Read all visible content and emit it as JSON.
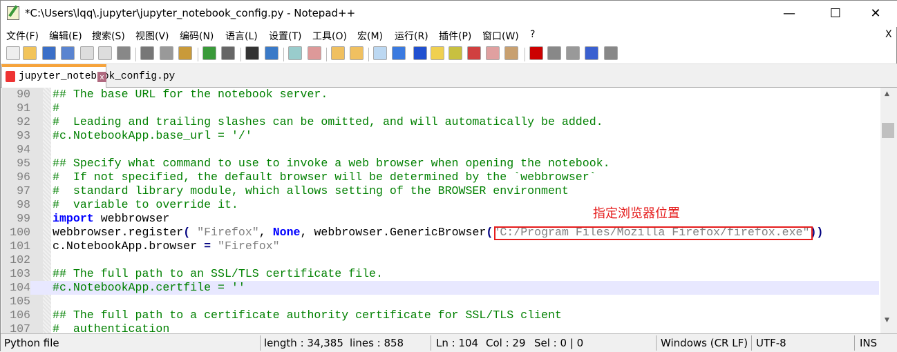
{
  "window": {
    "title": "*C:\\Users\\lqq\\.jupyter\\jupyter_notebook_config.py - Notepad++",
    "minimize": "—",
    "maximize": "☐",
    "close": "✕",
    "doc_close": "X"
  },
  "menu": [
    "文件(F)",
    "编辑(E)",
    "搜索(S)",
    "视图(V)",
    "编码(N)",
    "语言(L)",
    "设置(T)",
    "工具(O)",
    "宏(M)",
    "运行(R)",
    "插件(P)",
    "窗口(W)",
    "?"
  ],
  "toolbar": [
    "new-file",
    "open-file",
    "save",
    "save-all",
    "close",
    "close-all",
    "print",
    "cut",
    "copy",
    "paste",
    "undo",
    "redo",
    "find",
    "replace",
    "zoom-in",
    "zoom-out",
    "sync-vertical",
    "sync-horizontal",
    "word-wrap",
    "show-all-chars",
    "indent-guide",
    "language-define",
    "document-map",
    "function-list",
    "folder-workspace",
    "monitoring",
    "record-macro",
    "stop-record",
    "play-macro",
    "run-macro-multiple",
    "save-macro"
  ],
  "tab": {
    "label": "jupyter_notebook_config.py",
    "close": "x"
  },
  "lines": [
    {
      "n": "90",
      "seg": [
        [
          "cm",
          "## The base URL for the notebook server."
        ]
      ]
    },
    {
      "n": "91",
      "seg": [
        [
          "cm",
          "#"
        ]
      ]
    },
    {
      "n": "92",
      "seg": [
        [
          "cm",
          "#  Leading and trailing slashes can be omitted, and will automatically be added."
        ]
      ]
    },
    {
      "n": "93",
      "seg": [
        [
          "cm",
          "#c.NotebookApp.base_url = '/'"
        ]
      ]
    },
    {
      "n": "94",
      "seg": []
    },
    {
      "n": "95",
      "seg": [
        [
          "cm",
          "## Specify what command to use to invoke a web browser when opening the notebook."
        ]
      ]
    },
    {
      "n": "96",
      "seg": [
        [
          "cm",
          "#  If not specified, the default browser will be determined by the `webbrowser`"
        ]
      ]
    },
    {
      "n": "97",
      "seg": [
        [
          "cm",
          "#  standard library module, which allows setting of the BROWSER environment"
        ]
      ]
    },
    {
      "n": "98",
      "seg": [
        [
          "cm",
          "#  variable to override it."
        ]
      ]
    },
    {
      "n": "99",
      "seg": [
        [
          "kw",
          "import"
        ],
        [
          "df",
          " webbrowser"
        ]
      ]
    },
    {
      "n": "100",
      "seg": [
        [
          "df",
          "webbrowser.register"
        ],
        [
          "op",
          "("
        ],
        [
          "df",
          " "
        ],
        [
          "st",
          "\"Firefox\""
        ],
        [
          "df",
          ", "
        ],
        [
          "kw",
          "None"
        ],
        [
          "df",
          ", webbrowser.GenericBrowser"
        ],
        [
          "op",
          "("
        ],
        [
          "st",
          "\"C:/Program Files/Mozilla Firefox/firefox.exe\""
        ],
        [
          "op",
          "))"
        ]
      ]
    },
    {
      "n": "101",
      "seg": [
        [
          "df",
          "c.NotebookApp.browser "
        ],
        [
          "op",
          "="
        ],
        [
          "df",
          " "
        ],
        [
          "st",
          "\"Firefox\""
        ]
      ]
    },
    {
      "n": "102",
      "seg": []
    },
    {
      "n": "103",
      "seg": [
        [
          "cm",
          "## The full path to an SSL/TLS certificate file."
        ]
      ]
    },
    {
      "n": "104",
      "seg": [
        [
          "cm",
          "#c.NotebookApp.certfile = ''"
        ]
      ],
      "current": true
    },
    {
      "n": "105",
      "seg": []
    },
    {
      "n": "106",
      "seg": [
        [
          "cm",
          "## The full path to a certificate authority certificate for SSL/TLS client"
        ]
      ]
    },
    {
      "n": "107",
      "seg": [
        [
          "cm",
          "#  authentication"
        ]
      ]
    }
  ],
  "annotation": "指定浏览器位置",
  "status": {
    "type": "Python file",
    "length": "length : 34,385",
    "lines": "lines : 858",
    "ln": "Ln : 104",
    "col": "Col : 29",
    "sel": "Sel : 0 | 0",
    "eol": "Windows (CR LF)",
    "enc": "UTF-8",
    "mode": "INS"
  }
}
